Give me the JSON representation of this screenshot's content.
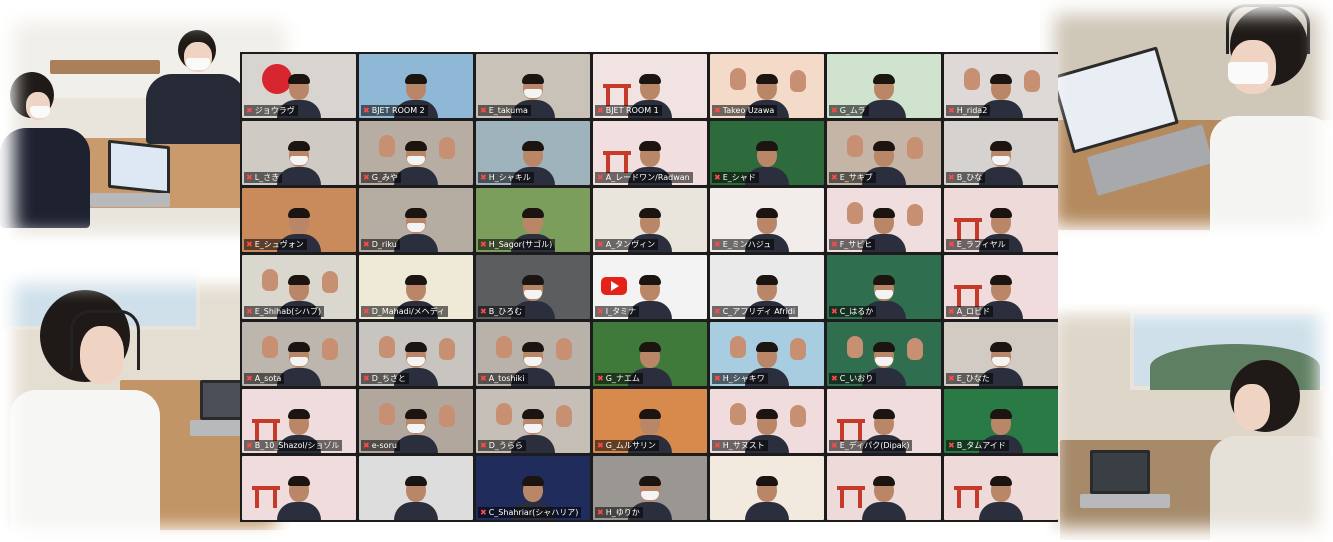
{
  "collage": {
    "grid": {
      "tiles": [
        {
          "label": "ジョウラヴ",
          "bg": "#d8d4d0",
          "kind": "kanji",
          "mask": false
        },
        {
          "label": "BJET ROOM 2",
          "bg": "#8fb7d6",
          "kind": "person",
          "mask": false
        },
        {
          "label": "E_takuma",
          "bg": "#c9c2b8",
          "kind": "person",
          "mask": true
        },
        {
          "label": "BJET ROOM 1",
          "bg": "#f2e3e3",
          "kind": "torii",
          "mask": false
        },
        {
          "label": "Takeo Uzawa",
          "bg": "#f4dbc9",
          "kind": "hand",
          "mask": false
        },
        {
          "label": "G_ムラ",
          "bg": "#cfe3cf",
          "kind": "person",
          "mask": false
        },
        {
          "label": "H_rida2",
          "bg": "#ded8d6",
          "kind": "hand",
          "mask": false
        },
        {
          "label": "L_さき",
          "bg": "#cfcac4",
          "kind": "person",
          "mask": true
        },
        {
          "label": "G_みや",
          "bg": "#b7ada3",
          "kind": "hand",
          "mask": true
        },
        {
          "label": "H_シャキル",
          "bg": "#9fb3bc",
          "kind": "person",
          "mask": false
        },
        {
          "label": "A_レードワン/Radwan",
          "bg": "#f1dede",
          "kind": "torii",
          "mask": false
        },
        {
          "label": "E_シャド",
          "bg": "#2e6b3c",
          "kind": "person",
          "mask": false
        },
        {
          "label": "E_サキブ",
          "bg": "#c4b5a6",
          "kind": "hand",
          "mask": false
        },
        {
          "label": "B_ひな",
          "bg": "#d6d2d0",
          "kind": "person",
          "mask": true
        },
        {
          "label": "E_シュヴォン",
          "bg": "#c98b5c",
          "kind": "person",
          "mask": false
        },
        {
          "label": "D_riku",
          "bg": "#b5aca2",
          "kind": "person",
          "mask": true
        },
        {
          "label": "H_Sagor(サゴル)",
          "bg": "#7c9e5d",
          "kind": "person",
          "mask": false
        },
        {
          "label": "A_タンヴィン",
          "bg": "#e9e4dc",
          "kind": "person",
          "mask": false
        },
        {
          "label": "E_ミンハジュ",
          "bg": "#f2ecea",
          "kind": "person",
          "mask": false
        },
        {
          "label": "F_サビヒ",
          "bg": "#f0dede",
          "kind": "hand",
          "mask": false
        },
        {
          "label": "E_ラフィヤル",
          "bg": "#efdada",
          "kind": "torii",
          "mask": false
        },
        {
          "label": "E_Shihab(シハブ)",
          "bg": "#d9d7ce",
          "kind": "hand",
          "mask": false
        },
        {
          "label": "D_Mahadi/メヘディ",
          "bg": "#efe9d8",
          "kind": "person",
          "mask": false
        },
        {
          "label": "B_ひろむ",
          "bg": "#5c5d5f",
          "kind": "person",
          "mask": true
        },
        {
          "label": "I_タミナ",
          "bg": "#f3f3f3",
          "kind": "youtube",
          "mask": false
        },
        {
          "label": "C_アフリディ Afridi",
          "bg": "#eaeaea",
          "kind": "person",
          "mask": false
        },
        {
          "label": "C_はるか",
          "bg": "#2f6e4e",
          "kind": "person",
          "mask": true
        },
        {
          "label": "A_ロビド",
          "bg": "#f0dcdc",
          "kind": "torii",
          "mask": false
        },
        {
          "label": "A_sota",
          "bg": "#bdb6ae",
          "kind": "hand",
          "mask": true
        },
        {
          "label": "D_ちさと",
          "bg": "#c8c4bf",
          "kind": "hand",
          "mask": true
        },
        {
          "label": "A_toshiki",
          "bg": "#b9b2aa",
          "kind": "hand",
          "mask": true
        },
        {
          "label": "G_ナエム",
          "bg": "#3f7a3b",
          "kind": "person",
          "mask": false
        },
        {
          "label": "H_シャキワ",
          "bg": "#a9cde0",
          "kind": "hand",
          "mask": false
        },
        {
          "label": "C_いおり",
          "bg": "#2f6e4e",
          "kind": "hand",
          "mask": true
        },
        {
          "label": "E_ひなた",
          "bg": "#d2cbc3",
          "kind": "person",
          "mask": true
        },
        {
          "label": "B_10_Shazol/ショゾル",
          "bg": "#f0dcdc",
          "kind": "torii",
          "mask": false
        },
        {
          "label": "e-soru",
          "bg": "#b1a79d",
          "kind": "hand",
          "mask": true
        },
        {
          "label": "D_うらら",
          "bg": "#c6bfb7",
          "kind": "hand",
          "mask": true
        },
        {
          "label": "G_ムルサリン",
          "bg": "#d88a4c",
          "kind": "person",
          "mask": false
        },
        {
          "label": "H_サヌスト",
          "bg": "#f0dcdc",
          "kind": "hand",
          "mask": false
        },
        {
          "label": "E_ディパク(Dipak)",
          "bg": "#f0dcdc",
          "kind": "torii",
          "mask": false
        },
        {
          "label": "B_タムアイド",
          "bg": "#2a7a46",
          "kind": "person",
          "mask": false
        },
        {
          "label": "",
          "bg": "#f0dcdc",
          "kind": "torii",
          "mask": false
        },
        {
          "label": "",
          "bg": "#dddddd",
          "kind": "person",
          "mask": false
        },
        {
          "label": "C_Shahriar(シャハリア)",
          "bg": "#1f2c5c",
          "kind": "person",
          "mask": false
        },
        {
          "label": "H_ゆりか",
          "bg": "#9a9792",
          "kind": "person",
          "mask": true
        },
        {
          "label": "",
          "bg": "#f3eadf",
          "kind": "person",
          "mask": false
        },
        {
          "label": "",
          "bg": "#efdada",
          "kind": "torii",
          "mask": false
        },
        {
          "label": "",
          "bg": "#efdada",
          "kind": "torii",
          "mask": false
        }
      ]
    }
  }
}
